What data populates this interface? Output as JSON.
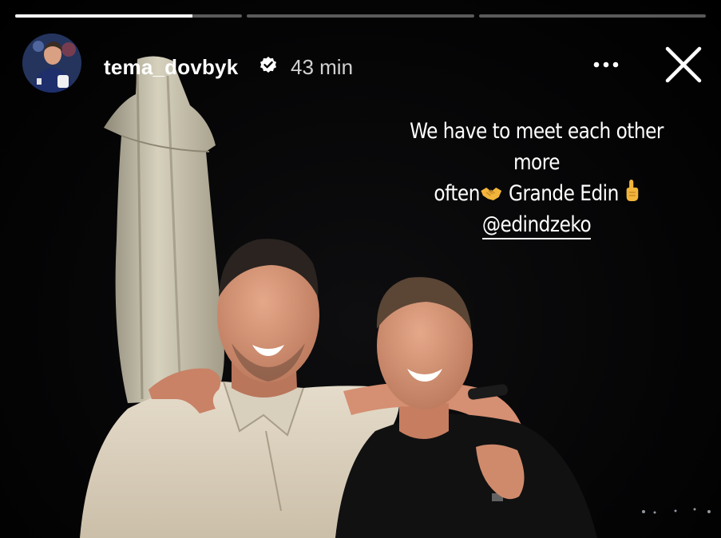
{
  "story": {
    "progress": [
      {
        "fraction": 0.78
      },
      {
        "fraction": 0
      },
      {
        "fraction": 0
      }
    ],
    "username": "tema_dovbyk",
    "time": "43 min",
    "caption_line1": "We have to meet each other more",
    "caption_line2_a": "often",
    "caption_line2_b": " Grande Edin ",
    "mention": "@edindzeko",
    "icons": {
      "verified": "verified-badge-icon",
      "more": "more-options-icon",
      "close": "close-icon",
      "handshake": "handshake-emoji",
      "point": "index-pointing-up-emoji"
    }
  }
}
